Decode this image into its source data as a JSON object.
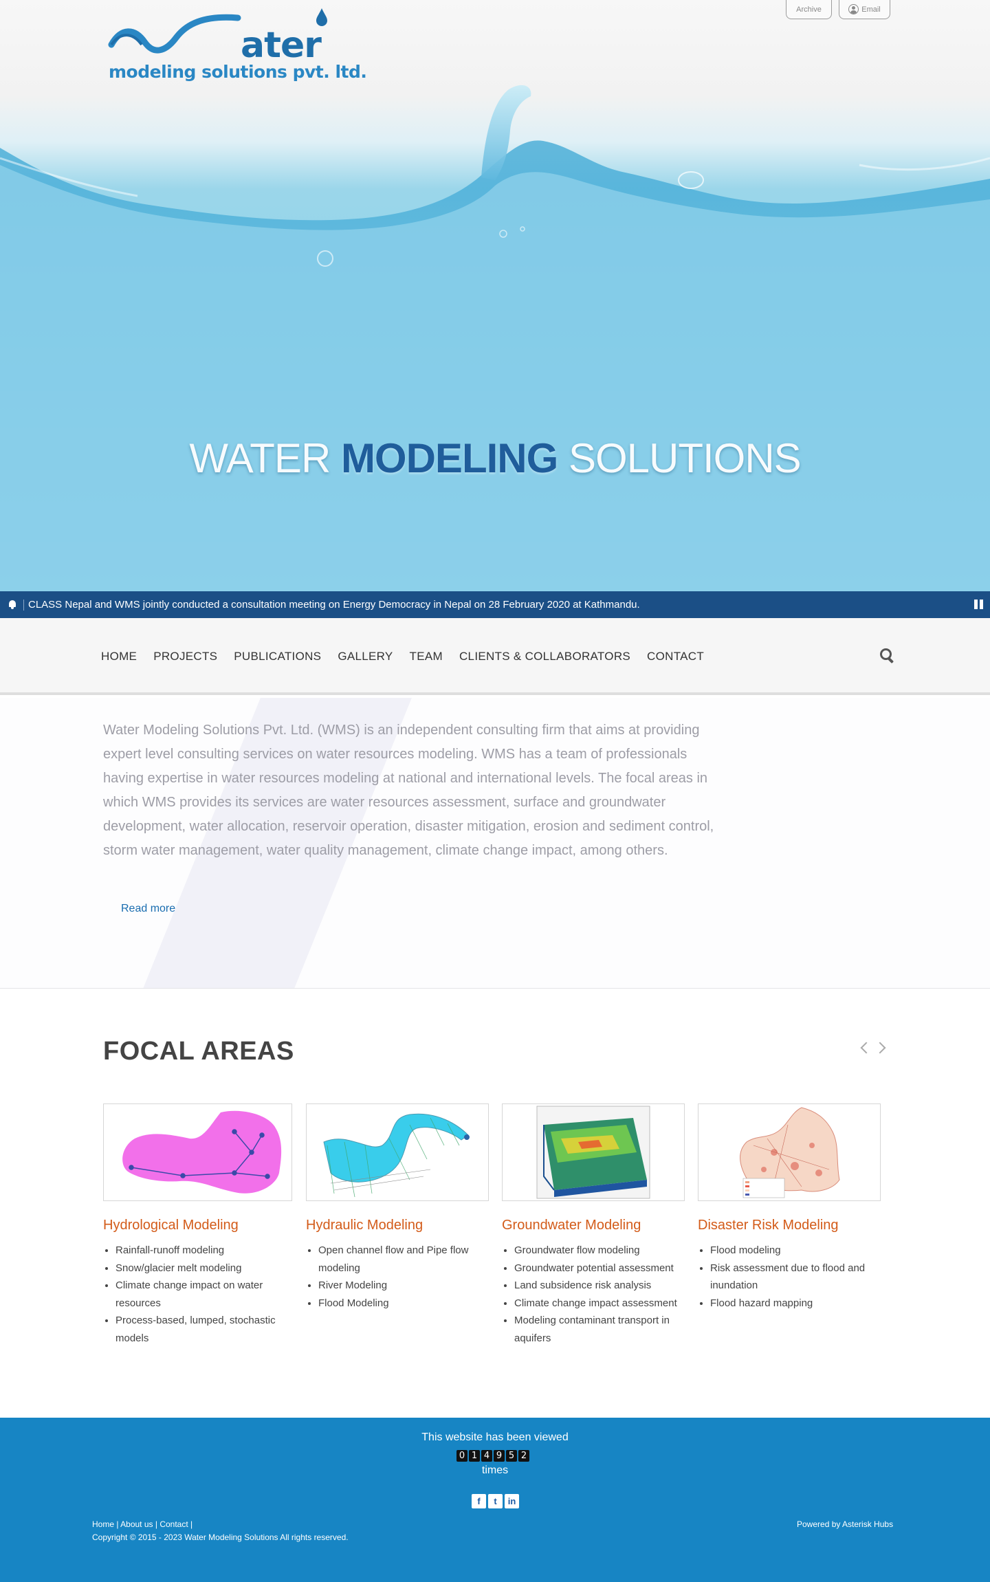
{
  "header": {
    "logo_word": "ater",
    "logo_subtitle": "modeling solutions pvt. ltd.",
    "archive_label": "Archive",
    "email_label": "Email"
  },
  "hero": {
    "title_part1": "WATER ",
    "title_bold": "MODELING",
    "title_part2": " SOLUTIONS"
  },
  "ticker": {
    "text": "CLASS Nepal and WMS jointly conducted a consultation meeting on Energy Democracy in Nepal on 28 February 2020 at Kathmandu."
  },
  "nav": {
    "items": [
      "HOME",
      "PROJECTS",
      "PUBLICATIONS",
      "GALLERY",
      "TEAM",
      "CLIENTS & COLLABORATORS",
      "CONTACT"
    ]
  },
  "intro": {
    "text": "Water Modeling Solutions Pvt. Ltd. (WMS) is an independent consulting firm that aims at providing expert level consulting services on water resources modeling. WMS has a team of professionals having expertise in water resources modeling at national and international levels. The focal areas in which WMS provides its services are water resources assessment, surface and groundwater development, water allocation, reservoir operation, disaster mitigation, erosion and sediment control, storm water management, water quality management, climate change impact, among others.",
    "read_more": "Read more"
  },
  "focal": {
    "title": "FOCAL AREAS",
    "cards": [
      {
        "title": "Hydrological Modeling",
        "items": [
          "Rainfall-runoff modeling",
          "Snow/glacier melt modeling",
          "Climate change impact on water resources",
          "Process-based, lumped, stochastic models"
        ]
      },
      {
        "title": "Hydraulic Modeling",
        "items": [
          "Open channel flow and Pipe flow modeling",
          "River Modeling",
          "Flood Modeling"
        ]
      },
      {
        "title": "Groundwater Modeling",
        "items": [
          "Groundwater flow modeling",
          "Groundwater potential assessment",
          "Land subsidence risk analysis",
          "Climate change impact assessment",
          "Modeling contaminant transport in aquifers"
        ]
      },
      {
        "title": "Disaster Risk Modeling",
        "items": [
          "Flood modeling",
          "Risk assessment due to flood and inundation",
          "Flood hazard mapping"
        ]
      }
    ]
  },
  "footer": {
    "viewed_text": "This website has been viewed",
    "counter_digits": [
      "0",
      "1",
      "4",
      "9",
      "5",
      "2"
    ],
    "times_text": "times",
    "social": [
      "f",
      "t",
      "in"
    ],
    "links": [
      "Home",
      "About us",
      "Contact"
    ],
    "copyright": "Copyright © 2015 - 2023 Water Modeling Solutions All rights reserved.",
    "powered_by": "Powered by Asterisk Hubs"
  },
  "colors": {
    "ticker_bg": "#1b4f86",
    "footer_bg": "#1785c4",
    "card_title": "#d35b19",
    "brand_blue": "#1f6ea9"
  }
}
